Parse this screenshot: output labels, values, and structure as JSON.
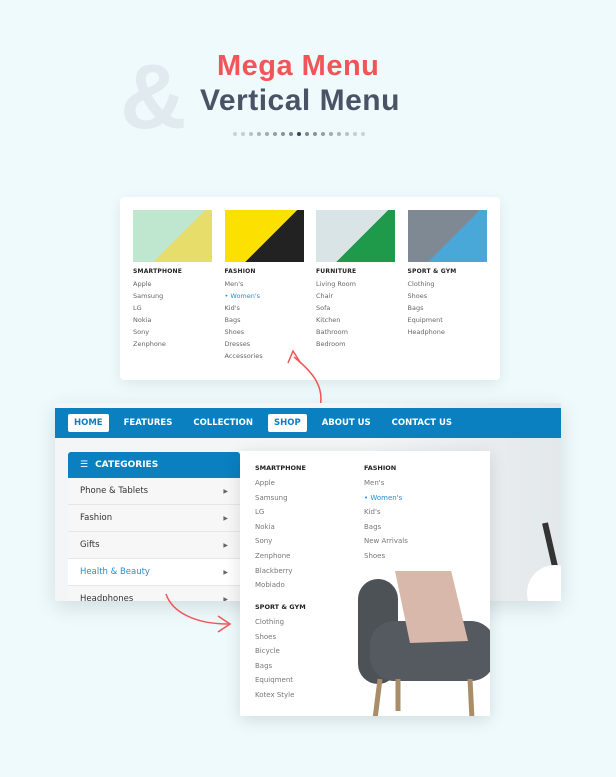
{
  "header": {
    "ampersand": "&",
    "title_line1": "Mega Menu",
    "title_line2": "Vertical Menu",
    "dots_count": 17,
    "active_dot": 8
  },
  "colors": {
    "accent_red": "#f25557",
    "nav_blue": "#0a80c0",
    "link_blue": "#2a8ed0",
    "title_dark": "#4a5366"
  },
  "mega_menu": {
    "columns": [
      {
        "heading": "SMARTPHONE",
        "image": "phones-image",
        "items": [
          "Apple",
          "Samsung",
          "LG",
          "Nokia",
          "Sony",
          "Zenphone"
        ]
      },
      {
        "heading": "FASHION",
        "image": "fashion-image",
        "items": [
          "Men's",
          "• Women's",
          "Kid's",
          "Bags",
          "Shoes",
          "Dresses",
          "Accessories"
        ],
        "active": 1
      },
      {
        "heading": "FURNITURE",
        "image": "furniture-image",
        "items": [
          "Living Room",
          "Chair",
          "Sofa",
          "Kitchen",
          "Bathroom",
          "Bedroom"
        ]
      },
      {
        "heading": "SPORT & GYM",
        "image": "sport-image",
        "items": [
          "Clothing",
          "Shoes",
          "Bags",
          "Equipment",
          "Headphone"
        ]
      }
    ]
  },
  "nav": {
    "items": [
      "HOME",
      "FEATURES",
      "COLLECTION",
      "SHOP",
      "ABOUT US",
      "CONTACT US"
    ],
    "active": [
      0,
      3
    ]
  },
  "categories": {
    "title": "CATEGORIES",
    "items": [
      "Phone & Tablets",
      "Fashion",
      "Gifts",
      "Health & Beauty",
      "Headphones"
    ],
    "active": 3
  },
  "dropdown": {
    "columns": [
      {
        "heading": "SMARTPHONE",
        "items": [
          "Apple",
          "Samsung",
          "LG",
          "Nokia",
          "Sony",
          "Zenphone",
          "Blackberry",
          "Mobiado"
        ]
      },
      {
        "heading": "FASHION",
        "items": [
          "Men's",
          "• Women's",
          "Kid's",
          "Bags",
          "New Arrivals",
          "Shoes"
        ],
        "active": 1
      },
      {
        "heading": "SPORT & GYM",
        "items": [
          "Clothing",
          "Shoes",
          "Bicycle",
          "Bags",
          "Equiqment",
          "Kotex Style"
        ]
      }
    ]
  }
}
